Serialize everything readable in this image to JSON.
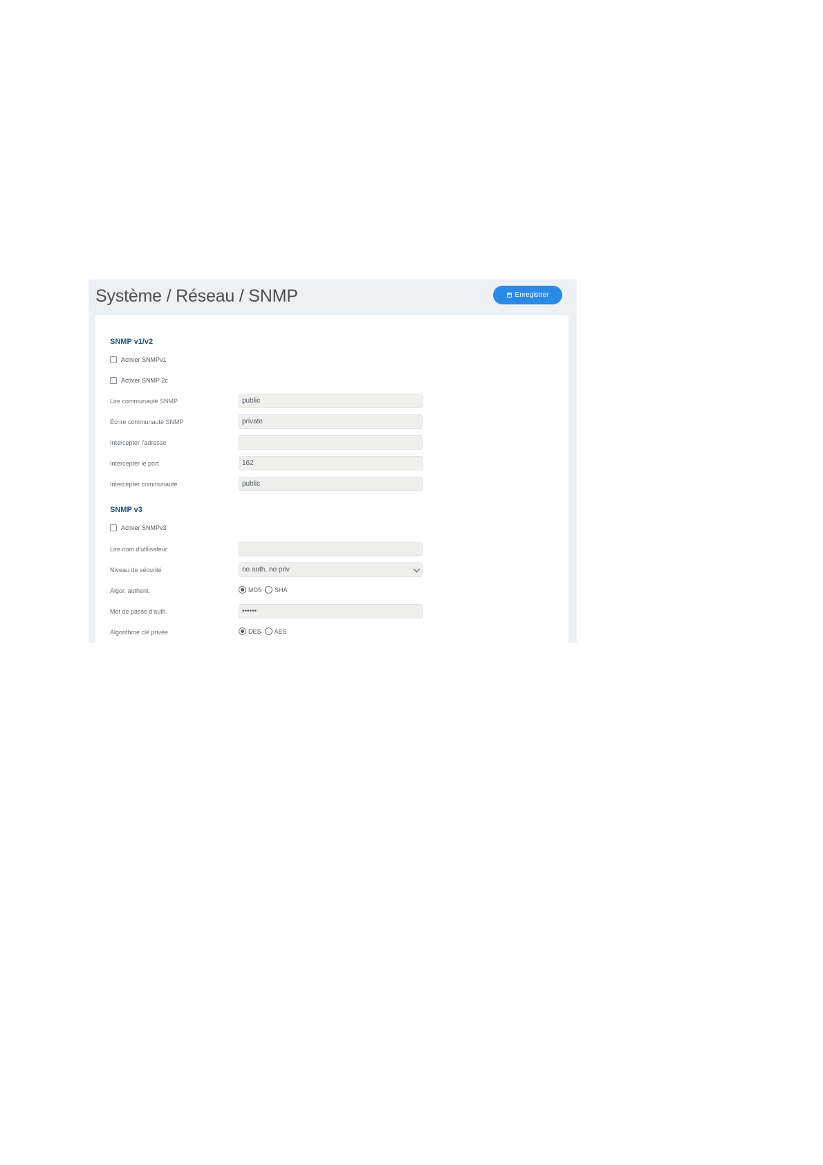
{
  "header": {
    "title": "Système / Réseau / SNMP",
    "save_label": "Enregistrer",
    "save_icon": "save-icon"
  },
  "colors": {
    "accent": "#2a8ae6",
    "section_title": "#1e4f8a",
    "frame_bg": "#edf1f5",
    "input_bg": "#efefed"
  },
  "snmp_v12": {
    "title": "SNMP v1/v2",
    "enable_v1": {
      "label": "Activer SNMPv1",
      "checked": false
    },
    "enable_v2c": {
      "label": "Activer SNMP 2c",
      "checked": false
    },
    "read_community": {
      "label": "Lire communauté SNMP",
      "value": "public"
    },
    "write_community": {
      "label": "Écrire communauté SNMP",
      "value": "private"
    },
    "trap_address": {
      "label": "Intercepter l'adresse",
      "value": ""
    },
    "trap_port": {
      "label": "Intercepter le port",
      "value": "162"
    },
    "trap_community": {
      "label": "Intercepter communauté",
      "value": "public"
    }
  },
  "snmp_v3": {
    "title": "SNMP v3",
    "enable_v3": {
      "label": "Activer SNMPv3",
      "checked": false
    },
    "username": {
      "label": "Lire nom d'utilisateur",
      "value": ""
    },
    "security_level": {
      "label": "Niveau de sécurité",
      "value": "no auth, no priv"
    },
    "auth_algo": {
      "label": "Algor. authent.",
      "options": [
        "MD5",
        "SHA"
      ],
      "selected": "MD5"
    },
    "auth_password": {
      "label": "Mot de passe d'auth.",
      "value": "••••••"
    },
    "priv_algo": {
      "label": "Algorithme clé privée",
      "options": [
        "DES",
        "AES"
      ],
      "selected": "DES"
    }
  }
}
